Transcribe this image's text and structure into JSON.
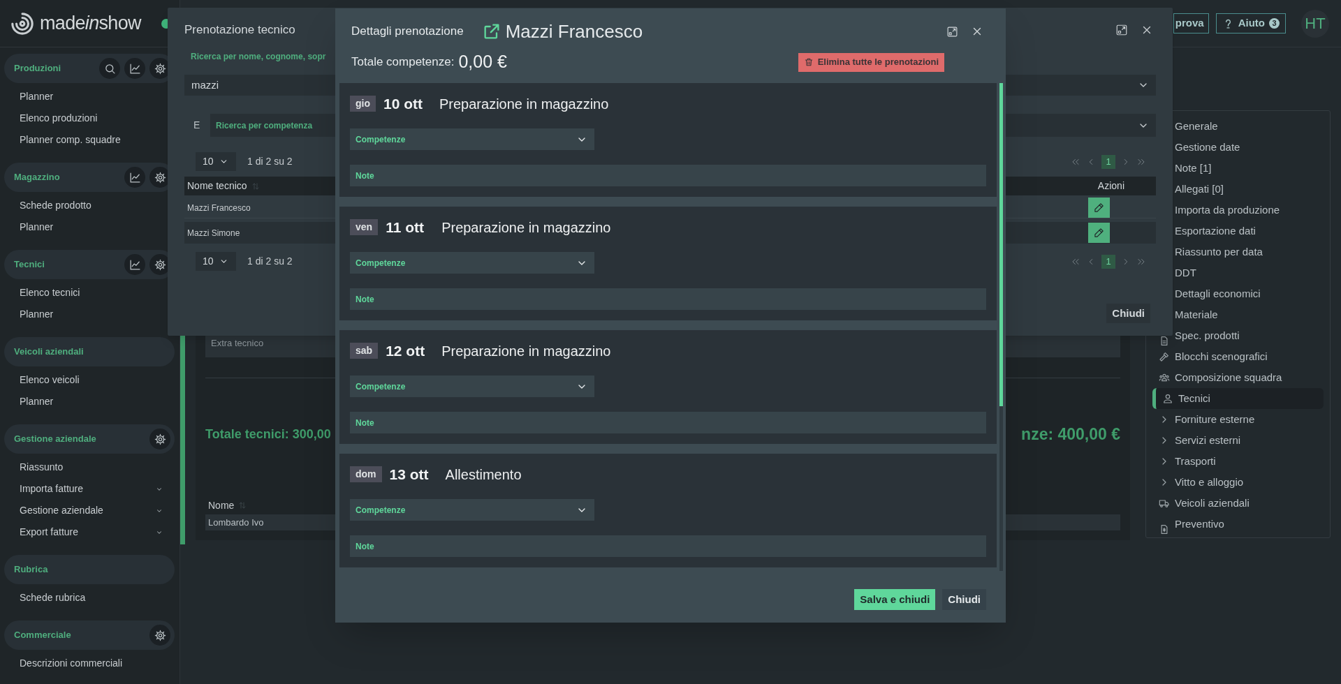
{
  "logo": {
    "parts": [
      {
        "text": "made",
        "italic": false
      },
      {
        "text": "in",
        "italic": true
      },
      {
        "text": "show",
        "italic": false
      }
    ],
    "online": true
  },
  "sidebar": {
    "sections": [
      {
        "title": "Produzioni",
        "actions": [
          {
            "kind": "search"
          },
          {
            "kind": "stats"
          },
          {
            "kind": "settings"
          }
        ],
        "items": [
          {
            "label": "Planner"
          },
          {
            "label": "Elenco produzioni"
          },
          {
            "label": "Planner comp. squadre"
          }
        ]
      },
      {
        "title": "Magazzino",
        "actions": [
          {
            "kind": "stats"
          },
          {
            "kind": "settings"
          }
        ],
        "items": [
          {
            "label": "Schede prodotto"
          },
          {
            "label": "Planner"
          }
        ]
      },
      {
        "title": "Tecnici",
        "actions": [
          {
            "kind": "stats"
          },
          {
            "kind": "settings"
          }
        ],
        "items": [
          {
            "label": "Elenco tecnici"
          },
          {
            "label": "Planner"
          }
        ]
      },
      {
        "title": "Veicoli aziendali",
        "items": [
          {
            "label": "Elenco veicoli"
          },
          {
            "label": "Planner"
          }
        ]
      },
      {
        "title": "Gestione aziendale",
        "actions": [
          {
            "kind": "settings"
          }
        ],
        "items": [
          {
            "label": "Riassunto",
            "expandable": false
          },
          {
            "label": "Importa fatture",
            "expandable": true
          },
          {
            "label": "Gestione aziendale",
            "expandable": true
          },
          {
            "label": "Export fatture",
            "expandable": true
          }
        ]
      },
      {
        "title": "Rubrica",
        "items": [
          {
            "label": "Schede rubrica"
          }
        ]
      },
      {
        "title": "Commerciale",
        "actions": [
          {
            "kind": "settings"
          }
        ],
        "items": [
          {
            "label": "Descrizioni commerciali"
          }
        ]
      }
    ]
  },
  "header": {
    "buttons": [
      {
        "label": "prova",
        "kind": "outline"
      },
      {
        "label": "Aiuto",
        "kind": "help",
        "badge": "3"
      }
    ],
    "avatar": "HT"
  },
  "main": {
    "fields": [
      {
        "label": "Extra tecnico"
      }
    ],
    "totals": [
      "Totale tecnici: 300,00",
      "nze: 400,00 €"
    ],
    "table": {
      "columns": [
        "Nome"
      ],
      "rows": [
        [
          "Lombardo Ivo"
        ]
      ]
    }
  },
  "right_panel": {
    "items": [
      {
        "label": "Generale",
        "kind": "plain",
        "selected": false
      },
      {
        "label": "Gestione date",
        "kind": "plain",
        "selected": false
      },
      {
        "label": "Note [1]",
        "kind": "plain",
        "selected": false
      },
      {
        "label": "Allegati [0]",
        "kind": "plain",
        "selected": false
      },
      {
        "label": "Importa da produzione",
        "kind": "plain",
        "selected": false
      },
      {
        "label": "Esportazione dati",
        "kind": "plain",
        "selected": false
      },
      {
        "label": "Riassunto per data",
        "kind": "plain",
        "selected": false
      },
      {
        "label": "DDT",
        "kind": "plain",
        "selected": false
      },
      {
        "label": "Dettagli economici",
        "kind": "plain",
        "selected": false
      },
      {
        "label": "Materiale",
        "kind": "plain",
        "selected": false
      },
      {
        "label": "Spec. prodotti",
        "kind": "sheet",
        "selected": false
      },
      {
        "label": "Blocchi scenografici",
        "kind": "tools",
        "selected": false
      },
      {
        "label": "Composizione squadra",
        "kind": "team",
        "selected": false
      },
      {
        "label": "Tecnici",
        "kind": "person",
        "selected": true
      },
      {
        "label": "Forniture esterne",
        "kind": "group",
        "selected": false
      },
      {
        "label": "Servizi esterni",
        "kind": "group",
        "selected": false
      },
      {
        "label": "Trasporti",
        "kind": "group",
        "selected": false
      },
      {
        "label": "Vitto e alloggio",
        "kind": "group",
        "selected": false
      },
      {
        "label": "Veicoli aziendali",
        "kind": "vehicle",
        "selected": false
      },
      {
        "label": "Preventivo",
        "kind": "quote",
        "selected": false
      }
    ]
  },
  "back_modal": {
    "title": "Prenotazione tecnico",
    "search": {
      "label": "Ricerca per nome, cognome, sopr",
      "value": "mazzi"
    },
    "connector": "E",
    "competence": {
      "label": "Ricerca per competenza"
    },
    "pagers": [
      {
        "page_size": "10",
        "range": "1 di 2 su 2",
        "pages": [
          {
            "label": "1",
            "selected": true
          }
        ]
      },
      {
        "page_size": "10",
        "range": "1 di 2 su 2",
        "pages": [
          {
            "label": "1",
            "selected": true
          }
        ]
      }
    ],
    "columns": [
      {
        "label": "Nome tecnico",
        "sortable": true
      },
      {
        "label": "Azioni",
        "sortable": false
      }
    ],
    "rows": [
      {
        "name": "Mazzi Francesco"
      },
      {
        "name": "Mazzi Simone"
      }
    ],
    "close_button": "Chiudi"
  },
  "front_modal": {
    "title": "Dettagli prenotazione",
    "name": "Mazzi Francesco",
    "total_label": "Totale competenze:",
    "total_value": "0,00 €",
    "delete_button": "Elimina tutte le prenotazioni",
    "bookings": [
      {
        "day": "gio",
        "date": "10 ott",
        "activity": "Preparazione in magazzino",
        "competences_label": "Competenze",
        "notes_label": "Note"
      },
      {
        "day": "ven",
        "date": "11 ott",
        "activity": "Preparazione in magazzino",
        "competences_label": "Competenze",
        "notes_label": "Note"
      },
      {
        "day": "sab",
        "date": "12 ott",
        "activity": "Preparazione in magazzino",
        "competences_label": "Competenze",
        "notes_label": "Note"
      },
      {
        "day": "dom",
        "date": "13 ott",
        "activity": "Allestimento",
        "competences_label": "Competenze",
        "notes_label": "Note"
      }
    ],
    "buttons": [
      {
        "label": "Salva e chiudi",
        "kind": "primary"
      },
      {
        "label": "Chiudi",
        "kind": "secondary"
      }
    ]
  }
}
